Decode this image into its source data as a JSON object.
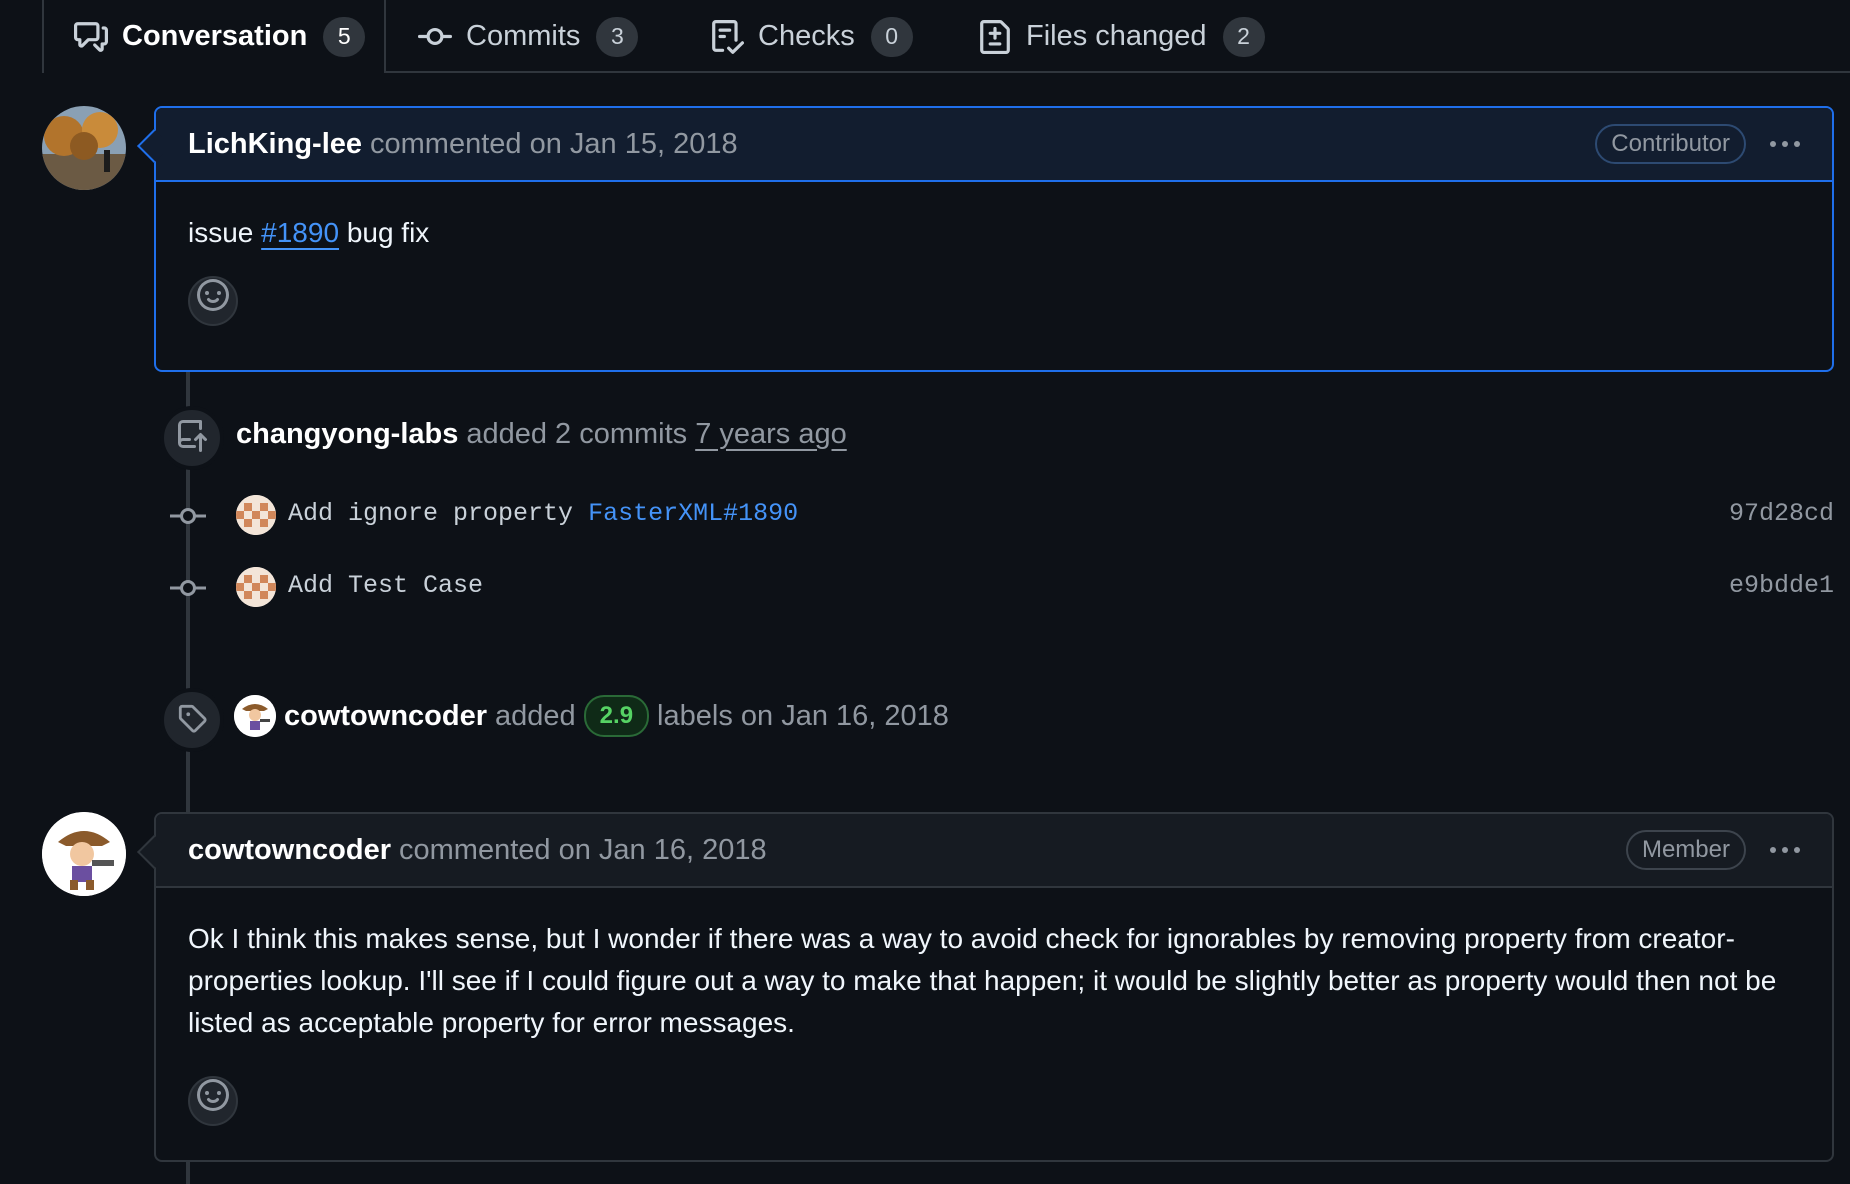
{
  "tabs": [
    {
      "label": "Conversation",
      "count": "5",
      "icon": "comment-discussion-icon"
    },
    {
      "label": "Commits",
      "count": "3",
      "icon": "git-commit-icon"
    },
    {
      "label": "Checks",
      "count": "0",
      "icon": "checklist-icon"
    },
    {
      "label": "Files changed",
      "count": "2",
      "icon": "file-diff-icon"
    }
  ],
  "comment1": {
    "author": "LichKing-lee",
    "meta": "commented on Jan 15, 2018",
    "role": "Contributor",
    "body_prefix": "issue",
    "body_link": "#1890",
    "body_suffix": "bug fix"
  },
  "commits_event": {
    "author": "changyong-labs",
    "action": "added 2 commits",
    "time": "7 years ago",
    "commits": [
      {
        "message": "Add ignore property",
        "link": "FasterXML#1890",
        "sha": "97d28cd"
      },
      {
        "message": "Add Test Case",
        "link": "",
        "sha": "e9bdde1"
      }
    ]
  },
  "label_event": {
    "author": "cowtowncoder",
    "action": "added",
    "label": "2.9",
    "suffix": "labels on Jan 16, 2018"
  },
  "comment2": {
    "author": "cowtowncoder",
    "meta": "commented on Jan 16, 2018",
    "role": "Member",
    "body": "Ok I think this makes sense, but I wonder if there was a way to avoid check for ignorables by removing property from creator-properties lookup. I'll see if I could figure out a way to make that happen; it would be slightly better as property would then not be listed as acceptable property for error messages."
  },
  "colors": {
    "background": "#0d1117",
    "accent_link": "#4493f8",
    "highlight_border": "#1f6feb",
    "label_green": "#56d364"
  }
}
